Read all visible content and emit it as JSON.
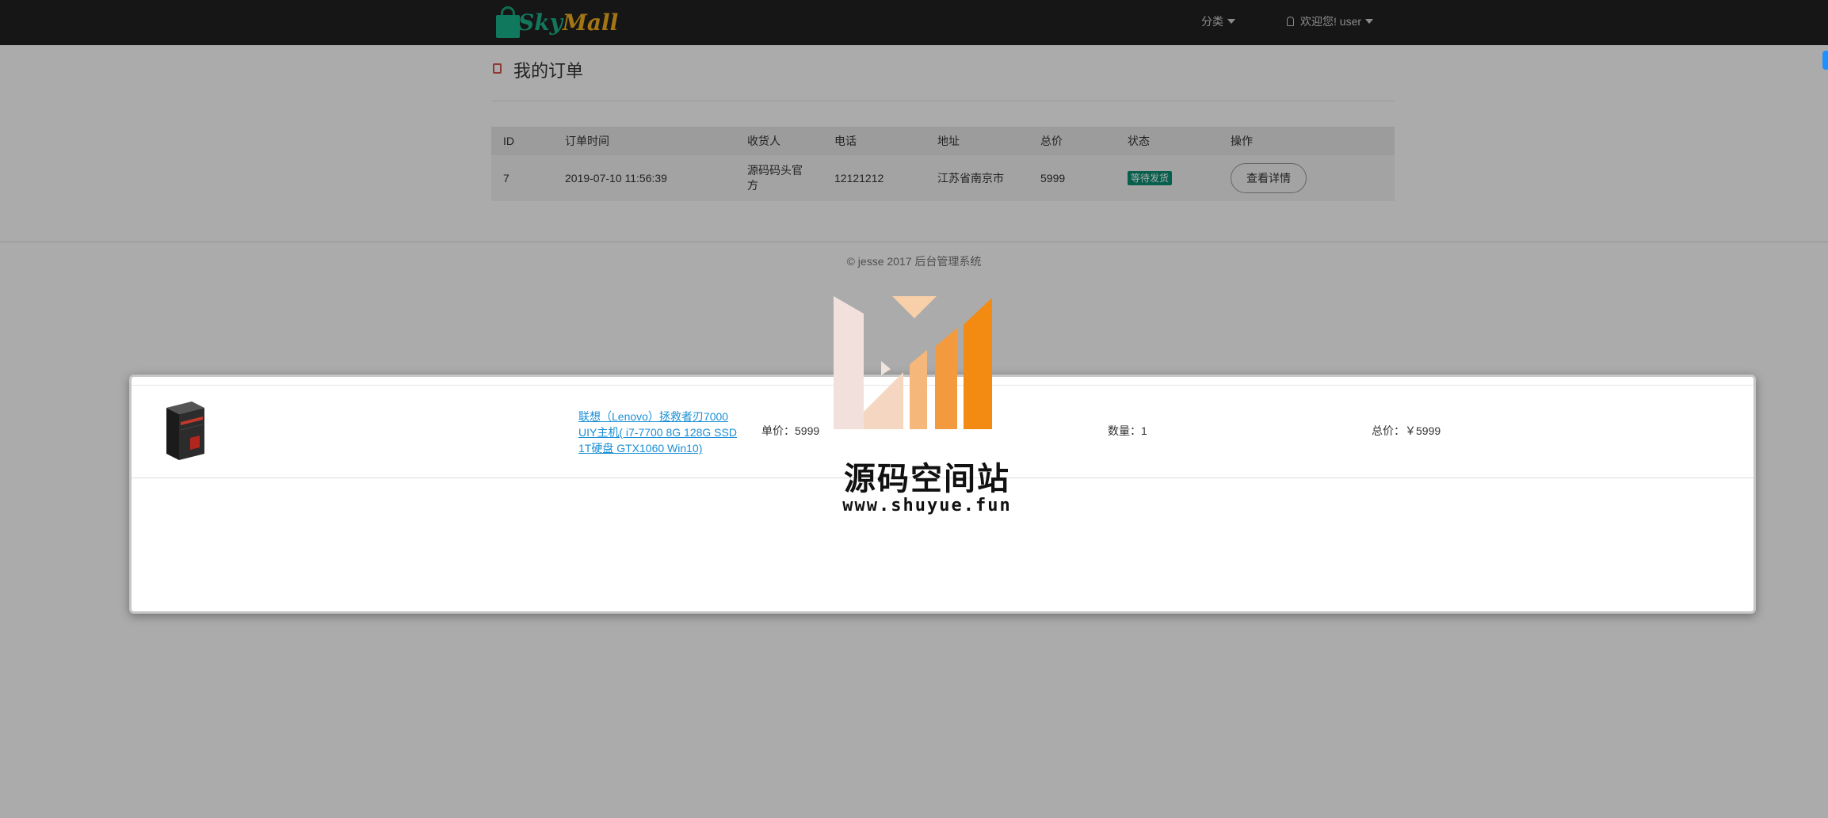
{
  "navbar": {
    "brand_sky": "Sky",
    "brand_mall": "Mall",
    "category_label": "分类",
    "welcome_label": "欢迎您! user"
  },
  "page": {
    "title": "我的订单"
  },
  "orders_table": {
    "headers": [
      "ID",
      "订单时间",
      "收货人",
      "电话",
      "地址",
      "总价",
      "状态",
      "操作"
    ],
    "rows": [
      {
        "id": "7",
        "time": "2019-07-10 11:56:39",
        "receiver": "源码码头官方",
        "phone": "12121212",
        "address": "江苏省南京市",
        "total": "5999",
        "status": "等待发货",
        "action": "查看详情"
      }
    ]
  },
  "footer": {
    "text": "© jesse 2017   后台管理系统"
  },
  "modal": {
    "product_name": "联想（Lenovo）拯救者刃7000 UIY主机( i7-7700 8G 128G SSD 1T硬盘 GTX1060 Win10)",
    "unit_price": "单价：5999",
    "quantity": "数量：1",
    "total_price": "总价：￥5999"
  },
  "watermark": {
    "title": "源码空间站",
    "url": "www.shuyue.fun"
  },
  "colors": {
    "navbar_bg": "#222222",
    "status_badge": "#0b8f73",
    "link": "#1a8fd6",
    "accent": "#d9534f"
  }
}
